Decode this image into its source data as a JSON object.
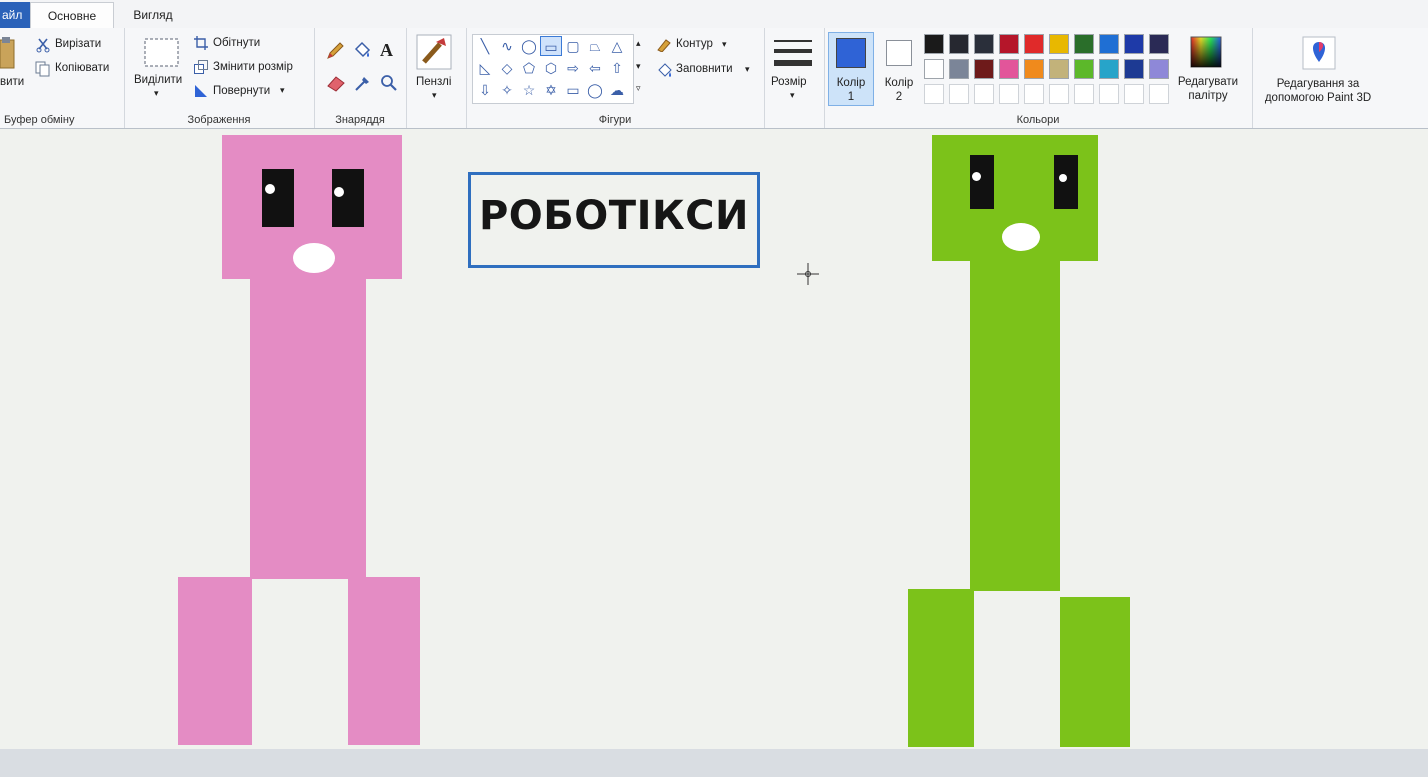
{
  "tabs": [
    {
      "label": "Файл",
      "visible_label": "айл"
    },
    {
      "label": "Основне"
    },
    {
      "label": "Вигляд"
    }
  ],
  "clipboard": {
    "paste_label": "Вставити",
    "paste_visible": "вити",
    "cut_label": "Вирізати",
    "copy_label": "Копіювати",
    "group_label": "Буфер обміну"
  },
  "image": {
    "select_label": "Виділити",
    "crop_label": "Обітнути",
    "resize_label": "Змінити розмір",
    "rotate_label": "Повернути",
    "group_label": "Зображення"
  },
  "tools": {
    "group_label": "Знаряддя"
  },
  "brushes": {
    "label": "Пензлі"
  },
  "shapes": {
    "outline_label": "Контур",
    "fill_label": "Заповнити",
    "group_label": "Фігури"
  },
  "size": {
    "label": "Розмір"
  },
  "colors": {
    "color1_label": "Колір",
    "color1_num": "1",
    "color2_label": "Колір",
    "color2_num": "2",
    "edit_palette_line1": "Редагувати",
    "edit_palette_line2": "палітру",
    "group_label": "Кольори",
    "color1_value": "#2f63d6",
    "color2_value": "#ffffff",
    "palette_row1": [
      "#1a1a1a",
      "#262830",
      "#2a2f3a",
      "#b5162a",
      "#e02a2a",
      "#e8b800",
      "#2a6e2a",
      "#1f6fd4",
      "#1e3aa8",
      "#2a2a55"
    ],
    "palette_row2": [
      "#ffffff",
      "#7b8598",
      "#6e1a1a",
      "#e2559a",
      "#f08a1c",
      "#c2b27a",
      "#5cb82a",
      "#27a4c9",
      "#1d3a93",
      "#8e88d8"
    ]
  },
  "paint3d": {
    "line1": "Редагування за",
    "line2": "допомогою Paint 3D"
  },
  "canvas": {
    "title": "РОБОТІКСИ",
    "pink_color": "#e48cc4",
    "green_color": "#7cc21a"
  }
}
